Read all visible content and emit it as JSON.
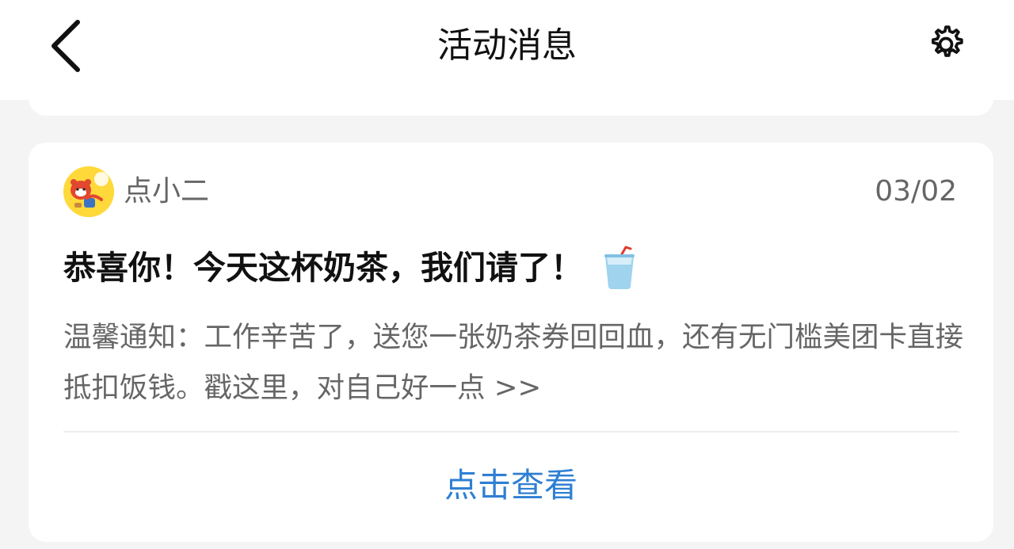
{
  "header": {
    "title": "活动消息"
  },
  "message": {
    "sender": "点小二",
    "date": "03/02",
    "title": "恭喜你！今天这杯奶茶，我们请了！",
    "body": "温馨通知：工作辛苦了，送您一张奶茶券回回血，还有无门槛美团卡直接抵扣饭钱。戳这里，对自己好一点 >>",
    "action_label": "点击查看"
  },
  "colors": {
    "accent": "#2f7fd3",
    "background": "#f4f4f4",
    "avatar_bg": "#ffd93a"
  },
  "icons": {
    "back": "chevron-left-icon",
    "settings": "gear-icon",
    "title_emoji": "cup-with-straw-icon",
    "avatar": "red-panda-mascot"
  }
}
